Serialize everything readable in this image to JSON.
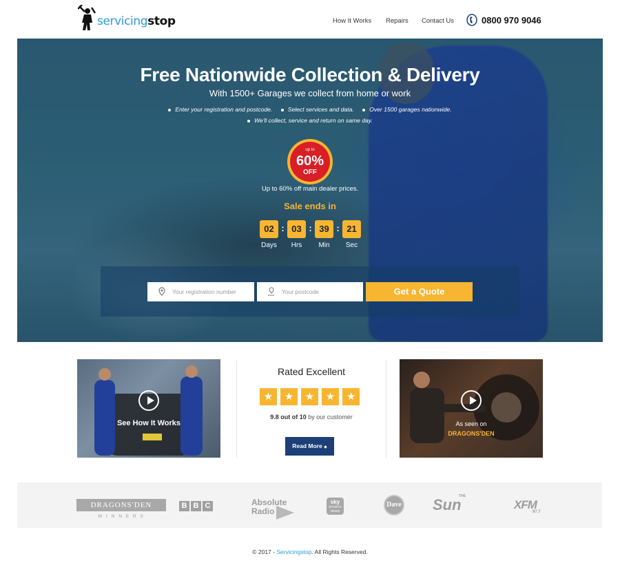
{
  "header": {
    "logo_text_a": "servicing",
    "logo_text_b": "stop",
    "nav": [
      "How It Works",
      "Repairs",
      "Contact Us"
    ],
    "phone": "0800 970 9046"
  },
  "hero": {
    "title": "Free Nationwide Collection & Delivery",
    "subtitle": "With 1500+ Garages we collect from home or work",
    "bullets_row1": [
      "Enter your registration and postcode.",
      "Select services and data.",
      "Over 1500 garages nationwide."
    ],
    "bullets_row2": [
      "We'll collect, service and return on same day."
    ],
    "badge": {
      "top": "up to",
      "percent": "60%",
      "off": "OFF"
    },
    "price_note": "Up to 60% off main dealer prices.",
    "sale_ends": "Sale ends in",
    "countdown": [
      {
        "value": "02",
        "label": "Days"
      },
      {
        "value": "03",
        "label": "Hrs"
      },
      {
        "value": "39",
        "label": "Min"
      },
      {
        "value": "21",
        "label": "Sec"
      }
    ],
    "registration_placeholder": "Your registration number",
    "postcode_placeholder": "Your postcode",
    "quote_button": "Get a Quote"
  },
  "features": {
    "left_caption": "See How It Works",
    "rated_title": "Rated Excellent",
    "stars": 5,
    "rating_strong": "9.8 out of 10",
    "rating_rest": "by our customer",
    "read_more": "Read More",
    "right_caption_1": "As seen on",
    "right_caption_2": "DRAGONS'DEN"
  },
  "press": {
    "dragons_1": "DRAGONS'DEN",
    "dragons_2": "W I N N E R S",
    "bbc": [
      "B",
      "B",
      "C"
    ],
    "absolute_1": "Absolute",
    "absolute_2": "Radio",
    "sky": [
      "sky",
      "SPORTS",
      "NEWS"
    ],
    "dave": "Dave",
    "sun_small": "THE",
    "sun": "Sun",
    "xfm": "XFM",
    "xfm_sub": "97.7"
  },
  "footer": {
    "prefix": "© 2017 - ",
    "link": "Servicingstop",
    "suffix": ". All Rights Reserved."
  },
  "colors": {
    "accent": "#f7b531",
    "brand_blue": "#2d9ad8",
    "button_navy": "#1c3f77"
  }
}
